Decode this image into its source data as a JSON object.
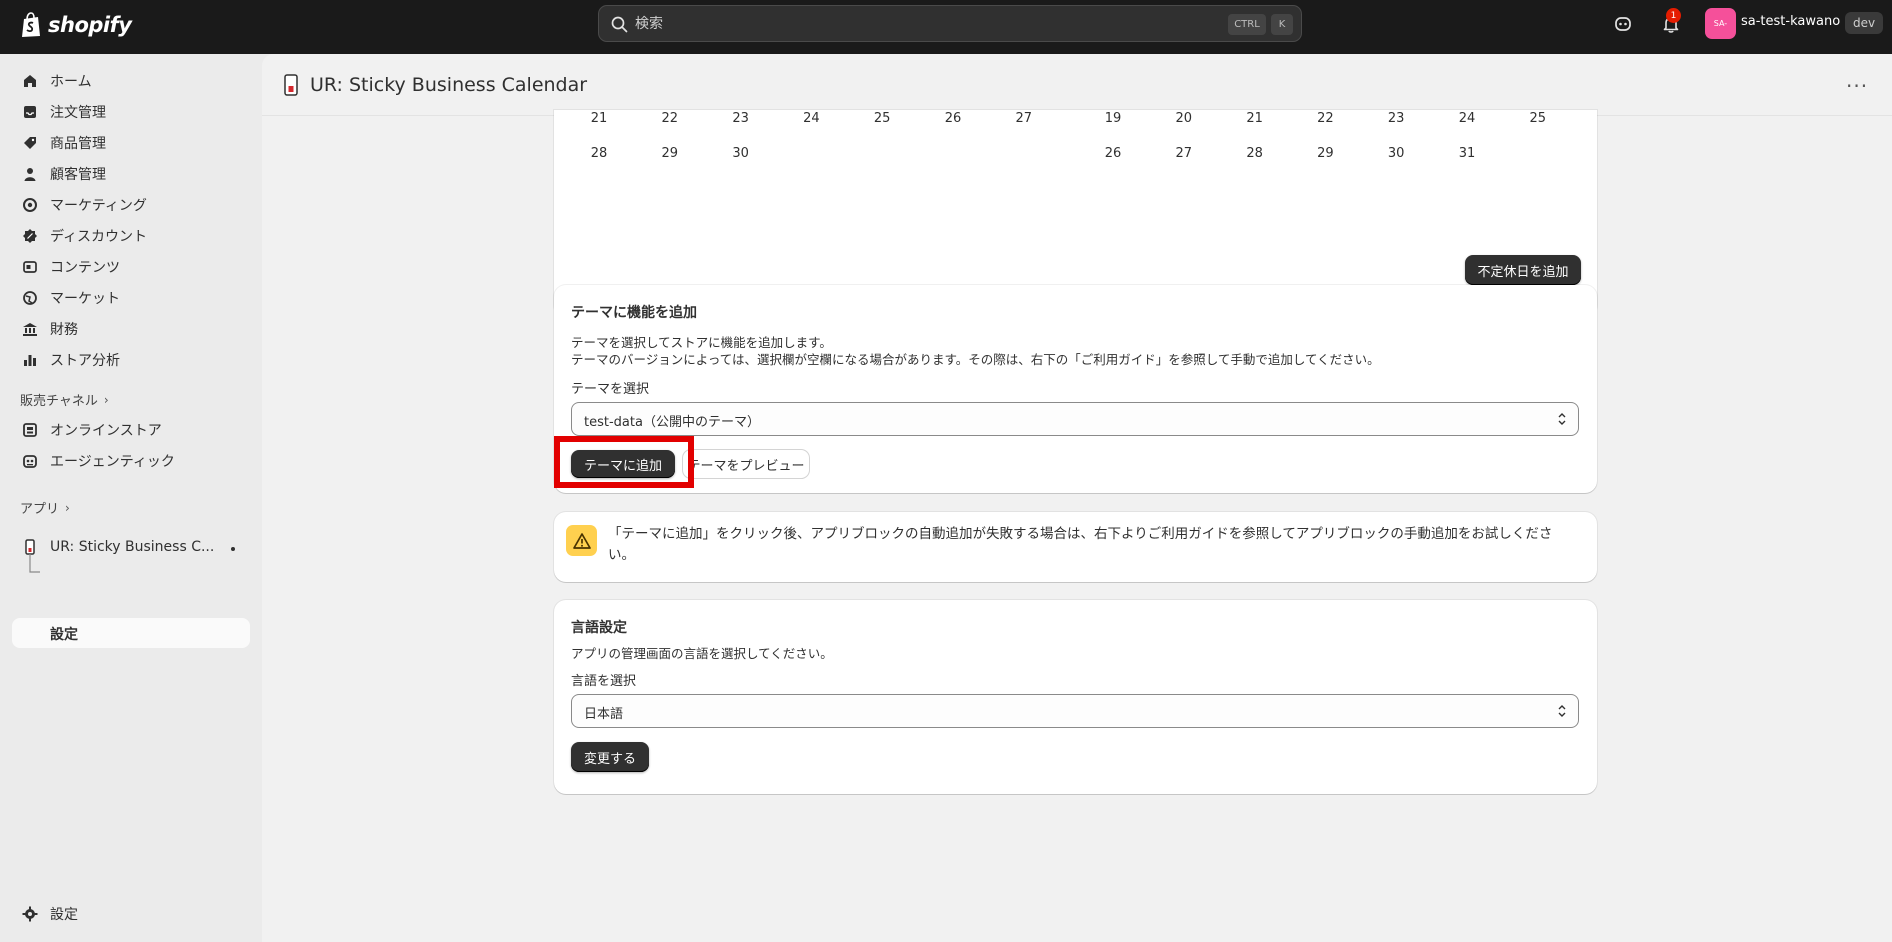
{
  "topbar": {
    "brand": "shopify",
    "search_placeholder": "検索",
    "kbd_ctrl": "CTRL",
    "kbd_k": "K",
    "notification_count": "1",
    "avatar_initials": "SA-",
    "store_name": "sa-test-kawano",
    "dev_badge": "dev"
  },
  "sidebar": {
    "items": [
      {
        "label": "ホーム",
        "icon": "home-icon"
      },
      {
        "label": "注文管理",
        "icon": "inbox-icon"
      },
      {
        "label": "商品管理",
        "icon": "tag-icon"
      },
      {
        "label": "顧客管理",
        "icon": "person-icon"
      },
      {
        "label": "マーケティング",
        "icon": "target-icon"
      },
      {
        "label": "ディスカウント",
        "icon": "discount-icon"
      },
      {
        "label": "コンテンツ",
        "icon": "content-icon"
      },
      {
        "label": "マーケット",
        "icon": "globe-icon"
      },
      {
        "label": "財務",
        "icon": "bank-icon"
      },
      {
        "label": "ストア分析",
        "icon": "chart-icon"
      }
    ],
    "sales_channels_label": "販売チャネル",
    "channels": [
      {
        "label": "オンラインストア",
        "icon": "store-icon"
      },
      {
        "label": "エージェンティック",
        "icon": "robot-icon"
      }
    ],
    "apps_label": "アプリ",
    "app_name": "UR: Sticky Business C...",
    "app_sub_item": "設定",
    "settings_label": "設定"
  },
  "page": {
    "title": "UR: Sticky Business Calendar",
    "more_label": "···"
  },
  "calendar": {
    "left_rows": [
      [
        "21",
        "22",
        "23",
        "24",
        "25",
        "26",
        "27"
      ],
      [
        "28",
        "29",
        "30"
      ]
    ],
    "right_rows": [
      [
        "19",
        "20",
        "21",
        "22",
        "23",
        "24",
        "25"
      ],
      [
        "26",
        "27",
        "28",
        "29",
        "30",
        "31"
      ]
    ],
    "add_holiday_button": "不定休日を追加"
  },
  "theme_card": {
    "title": "テーマに機能を追加",
    "desc_line1": "テーマを選択してストアに機能を追加します。",
    "desc_line2": "テーマのバージョンによっては、選択欄が空欄になる場合があります。その際は、右下の「ご利用ガイド」を参照して手動で追加してください。",
    "select_label": "テーマを選択",
    "select_value": "test-data（公開中のテーマ）",
    "add_button": "テーマに追加",
    "preview_button": "テーマをプレビュー"
  },
  "banner": {
    "text": "「テーマに追加」をクリック後、アプリブロックの自動追加が失敗する場合は、右下よりご利用ガイドを参照してアプリブロックの手動追加をお試しください。"
  },
  "language_card": {
    "title": "言語設定",
    "desc": "アプリの管理画面の言語を選択してください。",
    "select_label": "言語を選択",
    "select_value": "日本語",
    "change_button": "変更する"
  }
}
